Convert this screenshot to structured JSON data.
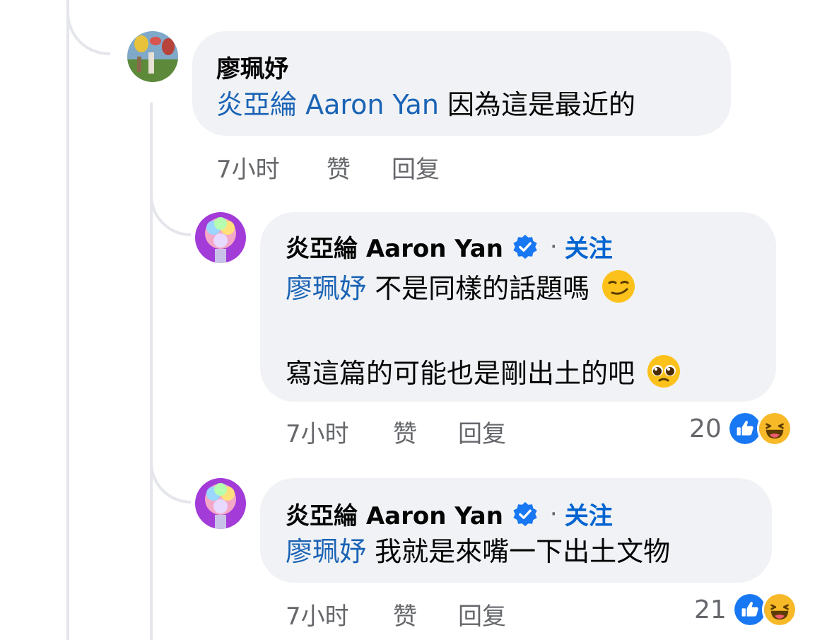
{
  "comments": [
    {
      "author": "廖珮妤",
      "mention": "炎亞綸 Aaron Yan",
      "text": "因為這是最近的",
      "time": "7小时",
      "like_label": "赞",
      "reply_label": "回复"
    },
    {
      "author": "炎亞綸 Aaron Yan",
      "separator": "·",
      "follow_label": "关注",
      "mention": "廖珮妤",
      "line1_text": "不是同樣的話題嗎",
      "line2_text": "寫這篇的可能也是剛出土的吧",
      "time": "7小时",
      "like_label": "赞",
      "reply_label": "回复",
      "reaction_count": "20",
      "emoji1": "smirking-face",
      "emoji2": "pleading-face"
    },
    {
      "author": "炎亞綸 Aaron Yan",
      "separator": "·",
      "follow_label": "关注",
      "mention": "廖珮妤",
      "text": "我就是來嘴一下出土文物",
      "time": "7小时",
      "like_label": "赞",
      "reply_label": "回复",
      "reaction_count": "21"
    }
  ],
  "colors": {
    "bubble": "#f0f2f5",
    "mention": "#1a63b5",
    "follow": "#0064d1",
    "meta": "#65676b",
    "like_blue": "#1877f2",
    "haha_yellow": "#f7b928"
  },
  "icons": {
    "verified": "verified-badge-icon",
    "like": "like-reaction-icon",
    "haha": "haha-reaction-icon"
  }
}
